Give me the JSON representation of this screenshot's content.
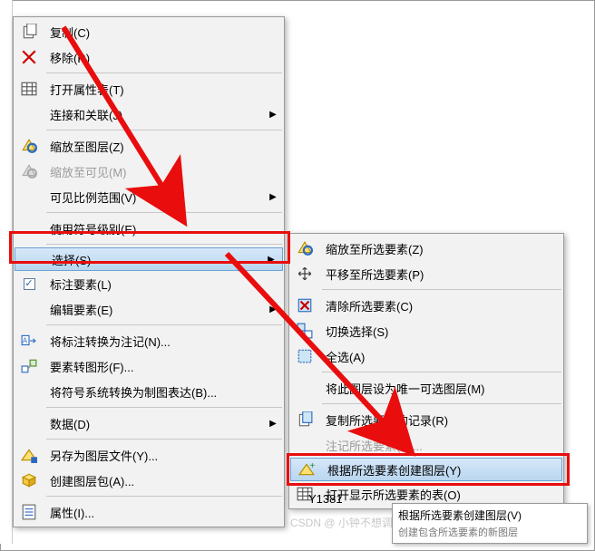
{
  "main_menu": {
    "items": [
      {
        "label": "复制(C)",
        "icon": "copy-icon",
        "interact": true
      },
      {
        "label": "移除(R)",
        "icon": "remove-icon",
        "interact": true
      },
      {
        "sep": true
      },
      {
        "label": "打开属性表(T)",
        "icon": "table-icon",
        "interact": true
      },
      {
        "label": "连接和关联(J)",
        "icon": null,
        "arrow": true,
        "interact": true
      },
      {
        "sep": true
      },
      {
        "label": "缩放至图层(Z)",
        "icon": "zoom-layer-icon",
        "interact": true
      },
      {
        "label": "缩放至可见(M)",
        "icon": "zoom-visible-icon",
        "disabled": true,
        "interact": false
      },
      {
        "label": "可见比例范围(V)",
        "icon": null,
        "arrow": true,
        "interact": true
      },
      {
        "sep": true
      },
      {
        "label": "使用符号级别(E)",
        "icon": null,
        "interact": true
      },
      {
        "sep": true
      },
      {
        "label": "选择(S)",
        "icon": null,
        "arrow": true,
        "highlight": true,
        "interact": true
      },
      {
        "label": "标注要素(L)",
        "icon": "checkbox",
        "interact": true
      },
      {
        "label": "编辑要素(E)",
        "icon": null,
        "arrow": true,
        "interact": true
      },
      {
        "sep": true
      },
      {
        "label": "将标注转换为注记(N)...",
        "icon": "convert-label-icon",
        "interact": true
      },
      {
        "label": "要素转图形(F)...",
        "icon": "feature-to-graphic-icon",
        "interact": true
      },
      {
        "label": "将符号系统转换为制图表达(B)...",
        "icon": null,
        "interact": true
      },
      {
        "sep": true
      },
      {
        "label": "数据(D)",
        "icon": null,
        "arrow": true,
        "interact": true
      },
      {
        "sep": true
      },
      {
        "label": "另存为图层文件(Y)...",
        "icon": "save-layer-icon",
        "interact": true
      },
      {
        "label": "创建图层包(A)...",
        "icon": "layer-package-icon",
        "interact": true
      },
      {
        "sep": true
      },
      {
        "label": "属性(I)...",
        "icon": "properties-icon",
        "interact": true
      }
    ]
  },
  "sub_menu": {
    "items": [
      {
        "label": "缩放至所选要素(Z)",
        "icon": "zoom-layer-icon",
        "interact": true
      },
      {
        "label": "平移至所选要素(P)",
        "icon": "pan-icon",
        "interact": true
      },
      {
        "sep": true
      },
      {
        "label": "清除所选要素(C)",
        "icon": "clear-selection-icon",
        "interact": true
      },
      {
        "label": "切换选择(S)",
        "icon": "switch-selection-icon",
        "interact": true
      },
      {
        "label": "全选(A)",
        "icon": "select-all-icon",
        "interact": true
      },
      {
        "sep": true
      },
      {
        "label": "将此图层设为唯一可选图层(M)",
        "icon": null,
        "interact": true
      },
      {
        "sep": true
      },
      {
        "label": "复制所选要素的记录(R)",
        "icon": "copy-records-icon",
        "interact": true
      },
      {
        "label": "注记所选要素(N)...",
        "icon": null,
        "disabled": true,
        "interact": false
      },
      {
        "label": "根据所选要素创建图层(Y)",
        "icon": "create-layer-icon",
        "highlight": true,
        "interact": true
      },
      {
        "label": "打开显示所选要素的表(O)",
        "icon": "table-icon",
        "interact": true
      }
    ]
  },
  "tooltip": {
    "title": "根据所选要素创建图层(V)",
    "desc": "创建包含所选要素的新图层"
  },
  "map_label": "Y1381",
  "watermark": "CSDN @ 小钟不想调代码了"
}
